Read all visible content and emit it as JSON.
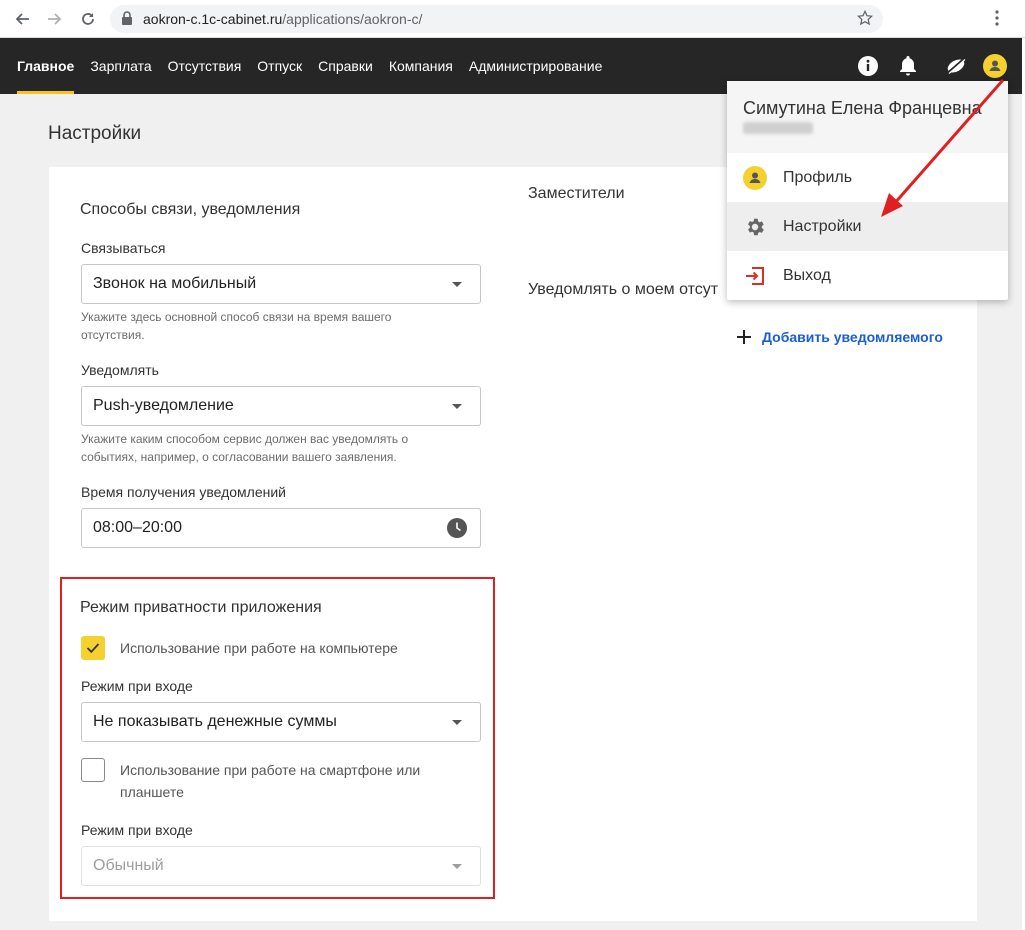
{
  "browser": {
    "url_host": "aokron-c.1c-cabinet.ru",
    "url_path": "/applications/aokron-c/"
  },
  "nav": {
    "items": [
      "Главное",
      "Зарплата",
      "Отсутствия",
      "Отпуск",
      "Справки",
      "Компания",
      "Администрирование"
    ],
    "active": "Главное"
  },
  "page": {
    "title": "Настройки"
  },
  "contact": {
    "section_title": "Способы связи, уведомления",
    "contact_label": "Связываться",
    "contact_value": "Звонок на мобильный",
    "contact_hint": "Укажите здесь основной способ связи на время вашего отсутствия.",
    "notify_label": "Уведомлять",
    "notify_value": "Push-уведомление",
    "notify_hint": "Укажите каким способом сервис должен вас уведомлять о событиях, например, о согласовании вашего заявления.",
    "time_label": "Время получения уведомлений",
    "time_value": "08:00–20:00"
  },
  "privacy": {
    "section_title": "Режим приватности приложения",
    "desktop_label": "Использование при работе на компьютере",
    "desktop_checked": true,
    "desktop_mode_label": "Режим при входе",
    "desktop_mode_value": "Не показывать денежные суммы",
    "mobile_label": "Использование при работе на смартфоне или планшете",
    "mobile_checked": false,
    "mobile_mode_label": "Режим при входе",
    "mobile_mode_value": "Обычный"
  },
  "right": {
    "deputies_title": "Заместители",
    "notify_absence_title": "Уведомлять о моем отсут",
    "add_notified": "Добавить уведомляемого"
  },
  "menu": {
    "user_name": "Симутина Елена Францевна",
    "items": [
      {
        "label": "Профиль",
        "icon": "person-icon"
      },
      {
        "label": "Настройки",
        "icon": "gear-icon"
      },
      {
        "label": "Выход",
        "icon": "logout-icon"
      }
    ]
  },
  "colors": {
    "header_bg": "#262626",
    "accent_yellow": "#f5c518",
    "link_blue": "#1a5fd1",
    "annotation_red": "#e02020"
  }
}
